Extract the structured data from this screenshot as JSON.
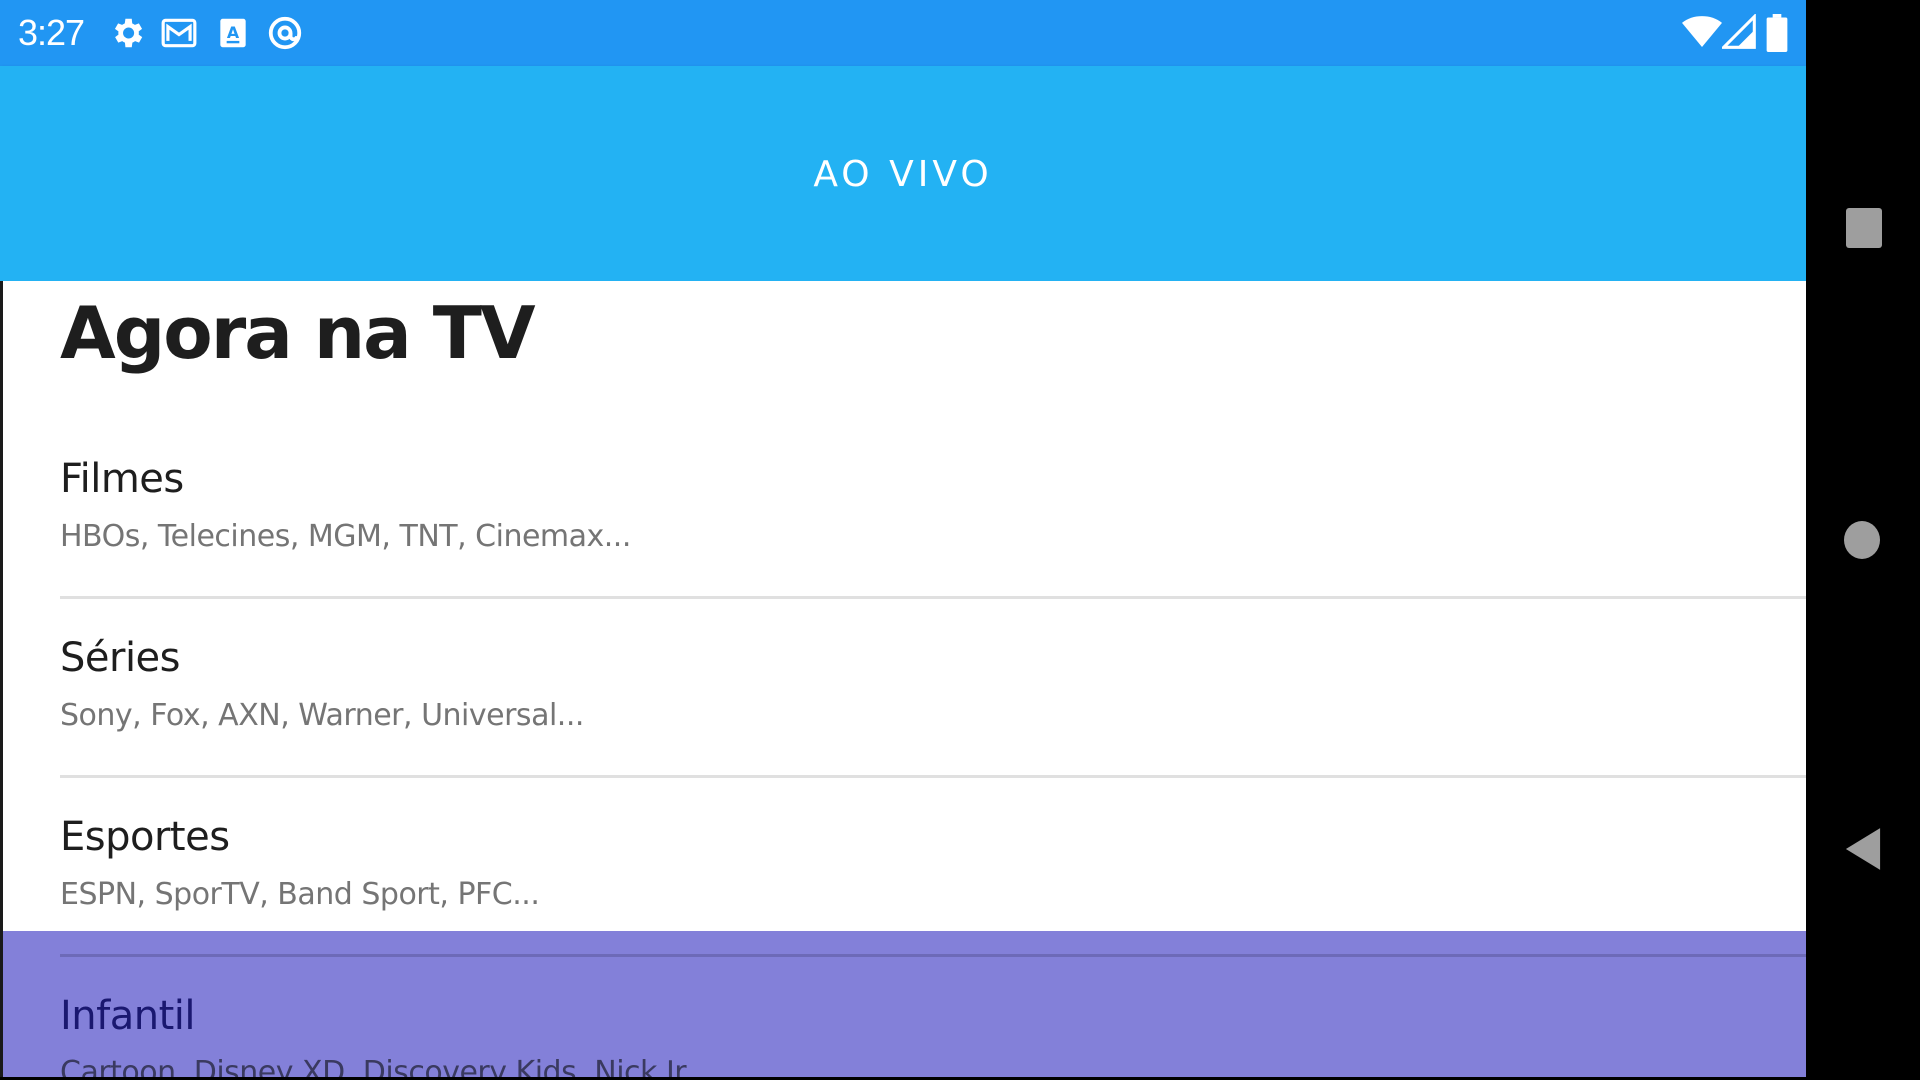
{
  "status_bar": {
    "time": "3:27",
    "left_icons": [
      "gear-icon",
      "gmail-icon",
      "font-app-icon",
      "at-sign-icon"
    ],
    "right_icons": [
      "wifi-icon",
      "signal-icon",
      "battery-icon"
    ],
    "background": "#2196F3"
  },
  "app_bar": {
    "title": "AO VIVO",
    "background": "#23B2F3"
  },
  "main": {
    "heading": "Agora na TV",
    "categories": [
      {
        "title": "Filmes",
        "subtitle": "HBOs, Telecines, MGM, TNT, Cinemax..."
      },
      {
        "title": "Séries",
        "subtitle": "Sony, Fox, AXN, Warner, Universal..."
      },
      {
        "title": "Esportes",
        "subtitle": "ESPN, SporTV, Band Sport, PFC..."
      },
      {
        "title": "Infantil",
        "subtitle": "Cartoon, Disney XD, Discovery Kids, Nick Jr...",
        "highlighted": true
      }
    ],
    "highlight_color": "#8380D9"
  },
  "nav_bar": {
    "buttons": [
      "recents-square-icon",
      "home-circle-icon",
      "back-triangle-icon"
    ]
  }
}
